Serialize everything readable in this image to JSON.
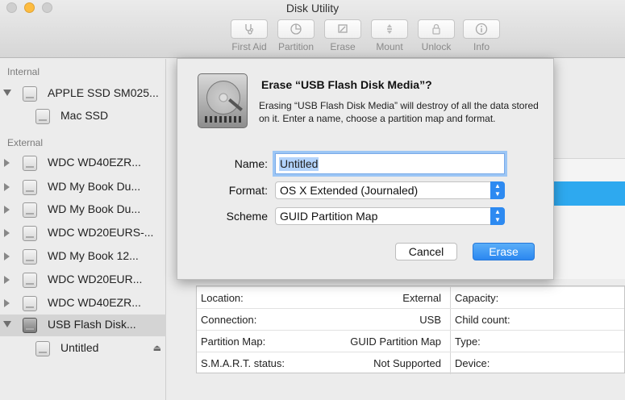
{
  "window": {
    "title": "Disk Utility"
  },
  "toolbar": {
    "items": [
      {
        "label": "First Aid",
        "icon": "stethoscope-icon"
      },
      {
        "label": "Partition",
        "icon": "pie-chart-icon"
      },
      {
        "label": "Erase",
        "icon": "eraser-icon"
      },
      {
        "label": "Mount",
        "icon": "mount-icon"
      },
      {
        "label": "Unlock",
        "icon": "lock-icon"
      },
      {
        "label": "Info",
        "icon": "info-icon"
      }
    ]
  },
  "sidebar": {
    "internal_label": "Internal",
    "external_label": "External",
    "internal": [
      {
        "label": "APPLE SSD SM025...",
        "level": 0
      },
      {
        "label": "Mac SSD",
        "level": 1
      }
    ],
    "external": [
      {
        "label": "WDC WD40EZR...",
        "level": 0
      },
      {
        "label": "WD My Book Du...",
        "level": 0
      },
      {
        "label": "WD My Book Du...",
        "level": 0
      },
      {
        "label": "WDC WD20EURS-...",
        "level": 0
      },
      {
        "label": "WD My Book 12...",
        "level": 0
      },
      {
        "label": "WDC WD20EUR...",
        "level": 0
      },
      {
        "label": "WDC WD40EZR...",
        "level": 0
      },
      {
        "label": "USB Flash Disk...",
        "level": 0,
        "selected": true
      },
      {
        "label": "Untitled",
        "level": 1
      }
    ]
  },
  "dialog": {
    "title": "Erase “USB Flash Disk Media”?",
    "message": "Erasing “USB Flash Disk Media” will destroy of all the data stored on it. Enter a name, choose a partition map and format.",
    "name_label": "Name:",
    "name_value": "Untitled",
    "format_label": "Format:",
    "format_value": "OS X Extended (Journaled)",
    "scheme_label": "Scheme",
    "scheme_value": "GUID Partition Map",
    "cancel_label": "Cancel",
    "erase_label": "Erase"
  },
  "info_table": {
    "rows": [
      {
        "left_key": "Location:",
        "left_value": "External",
        "right_key": "Capacity:"
      },
      {
        "left_key": "Connection:",
        "left_value": "USB",
        "right_key": "Child count:"
      },
      {
        "left_key": "Partition Map:",
        "left_value": "GUID Partition Map",
        "right_key": "Type:"
      },
      {
        "left_key": "S.M.A.R.T. status:",
        "left_value": "Not Supported",
        "right_key": "Device:"
      }
    ]
  },
  "colors": {
    "accent": "#2d8af1",
    "selection_band": "#2ea9ef"
  }
}
